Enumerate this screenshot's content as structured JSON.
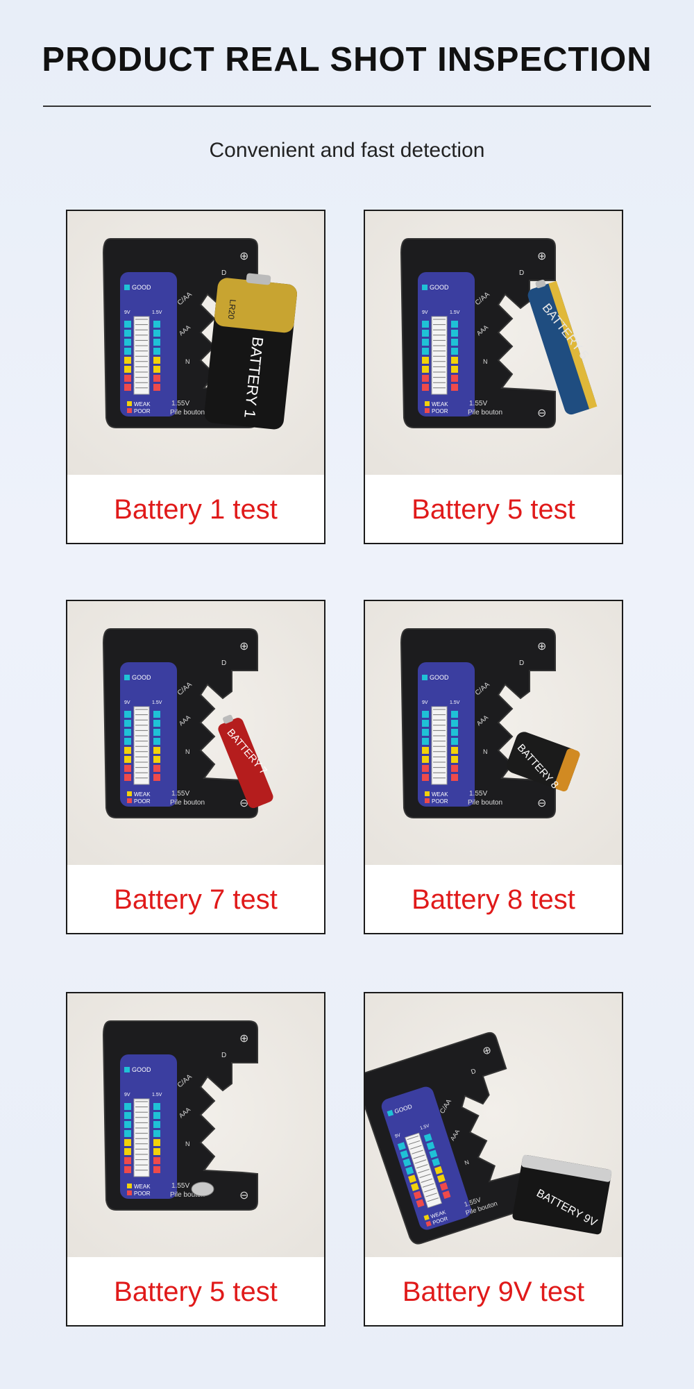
{
  "header": {
    "title": "PRODUCT REAL SHOT INSPECTION",
    "subtitle": "Convenient and fast detection"
  },
  "tester_labels": {
    "good": "GOOD",
    "weak": "WEAK",
    "poor": "POOR",
    "voltage": "1.55V",
    "button": "Pile bouton",
    "v9": "9V",
    "v15": "1.5V",
    "slot_d": "D",
    "slot_caa": "C/AA",
    "slot_aaa": "AAA",
    "slot_n": "N",
    "plus": "⊕",
    "minus": "⊖"
  },
  "cards": [
    {
      "caption": "Battery 1 test",
      "battery_label": "BATTERY 1",
      "battery_code": "LR20",
      "battery_type": "D",
      "colors": {
        "top": "#c8a431",
        "body": "#151515"
      }
    },
    {
      "caption": "Battery 5 test",
      "battery_label": "BATTERY 5",
      "battery_type": "AA",
      "colors": {
        "top": "#e0b83a",
        "body": "#1f4d80"
      }
    },
    {
      "caption": "Battery 7 test",
      "battery_label": "BATTERY 7",
      "battery_type": "AAA",
      "colors": {
        "top": "#bbbbbb",
        "body": "#b51d1d"
      }
    },
    {
      "caption": "Battery 8 test",
      "battery_label": "BATTERY 8",
      "battery_type": "N",
      "colors": {
        "top": "#d18a22",
        "body": "#1b1b1b"
      }
    },
    {
      "caption": "Battery 5 test",
      "battery_label": "",
      "battery_type": "button",
      "colors": {
        "top": "#c9c9c9",
        "body": "#999999"
      }
    },
    {
      "caption": "Battery 9V test",
      "battery_label": "BATTERY 9V",
      "battery_type": "9V",
      "colors": {
        "top": "#cfcfcf",
        "body": "#161616"
      }
    }
  ]
}
